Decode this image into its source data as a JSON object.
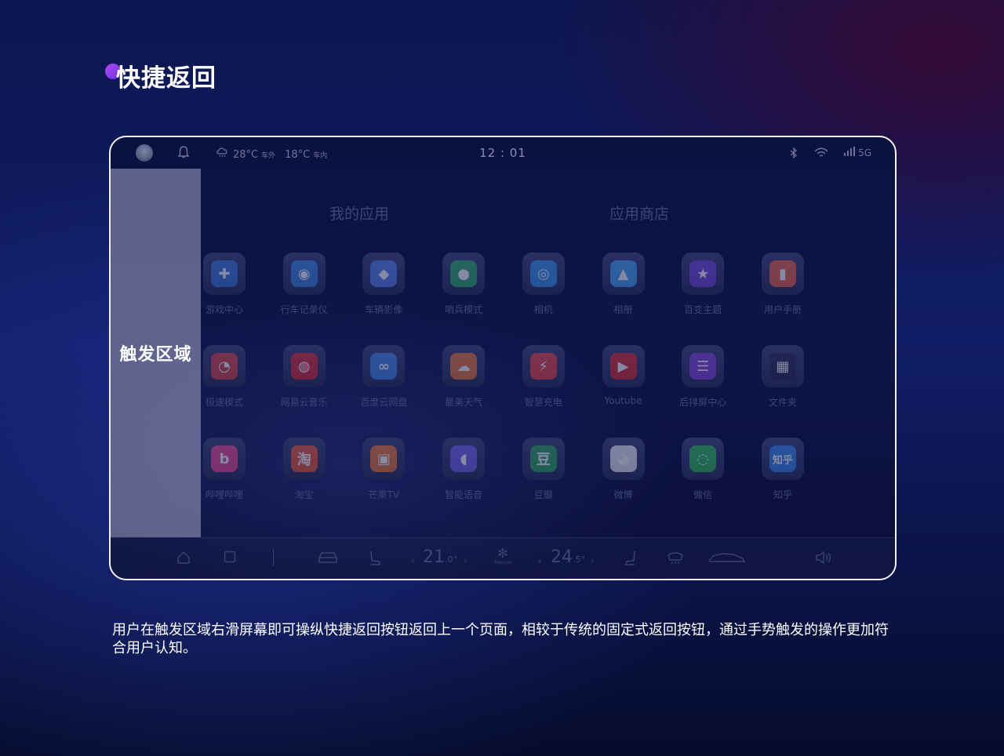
{
  "page": {
    "title": "快捷返回",
    "description": "用户在触发区域右滑屏幕即可操纵快捷返回按钮返回上一个页面，相较于传统的固定式返回按钮，通过手势触发的操作更加符合用户认知。"
  },
  "statusbar": {
    "outside_temp": "28°C",
    "outside_label": "车外",
    "inside_temp": "18°C",
    "inside_label": "车内",
    "clock": "12 : 01",
    "network": "5G"
  },
  "trigger_area": {
    "label": "触发区域"
  },
  "sections": {
    "my_apps": "我的应用",
    "app_store": "应用商店"
  },
  "apps": [
    {
      "label": "游戏中心",
      "icon": "gamepad-icon",
      "color": "#2f6fd8",
      "glyph": "✚"
    },
    {
      "label": "行车记录仪",
      "icon": "dashcam-icon",
      "color": "#2e7fe0",
      "glyph": "◉"
    },
    {
      "label": "车辆影像",
      "icon": "car-camera-icon",
      "color": "#4a78e8",
      "glyph": "◆"
    },
    {
      "label": "哨兵模式",
      "icon": "sentry-icon",
      "color": "#24a860",
      "glyph": "●"
    },
    {
      "label": "相机",
      "icon": "camera-icon",
      "color": "#2a8ee8",
      "glyph": "◎"
    },
    {
      "label": "相册",
      "icon": "gallery-icon",
      "color": "#3a9ef0",
      "glyph": "▲"
    },
    {
      "label": "百变主题",
      "icon": "theme-icon",
      "color": "#6a3ad8",
      "glyph": "★"
    },
    {
      "label": "用户手册",
      "icon": "manual-icon",
      "color": "#e85a3a",
      "glyph": "▮"
    },
    {
      "label": "极速模式",
      "icon": "speed-mode-icon",
      "color": "#d83a3a",
      "glyph": "◔"
    },
    {
      "label": "网易云音乐",
      "icon": "netease-music-icon",
      "color": "#d8202a",
      "glyph": "◍"
    },
    {
      "label": "百度云网盘",
      "icon": "baidu-netdisk-icon",
      "color": "#3a7fe8",
      "glyph": "∞"
    },
    {
      "label": "最美天气",
      "icon": "weather-icon",
      "color": "#e8702a",
      "glyph": "☁"
    },
    {
      "label": "智慧充电",
      "icon": "charging-icon",
      "color": "#e83a3a",
      "glyph": "⚡"
    },
    {
      "label": "Youtube",
      "icon": "youtube-icon",
      "color": "#d82020",
      "glyph": "▶"
    },
    {
      "label": "后排屏中心",
      "icon": "rear-screen-icon",
      "color": "#7a3ad8",
      "glyph": "☰"
    },
    {
      "label": "文件夹",
      "icon": "folder-icon",
      "color": "#1a1e44",
      "glyph": "▦"
    },
    {
      "label": "哔哩哔哩",
      "icon": "bilibili-icon",
      "color": "#e8408a",
      "glyph": "b"
    },
    {
      "label": "淘宝",
      "icon": "taobao-icon",
      "color": "#e8502a",
      "glyph": "淘"
    },
    {
      "label": "芒果TV",
      "icon": "mango-tv-icon",
      "color": "#e8702a",
      "glyph": "▣"
    },
    {
      "label": "智能语音",
      "icon": "voice-icon",
      "color": "#6a5ae8",
      "glyph": "◖"
    },
    {
      "label": "豆瓣",
      "icon": "douban-icon",
      "color": "#20a050",
      "glyph": "豆"
    },
    {
      "label": "微博",
      "icon": "weibo-icon",
      "color": "#e8e8ee",
      "glyph": "◕"
    },
    {
      "label": "微信",
      "icon": "wechat-icon",
      "color": "#24b84a",
      "glyph": "◌"
    },
    {
      "label": "知乎",
      "icon": "zhihu-icon",
      "color": "#2a7fe8",
      "glyph": "知乎"
    }
  ],
  "dock": {
    "left_temp": "21",
    "left_temp_dec": ".0°",
    "right_temp": "24",
    "right_temp_dec": ".5°",
    "fan_mode": "Manual"
  }
}
